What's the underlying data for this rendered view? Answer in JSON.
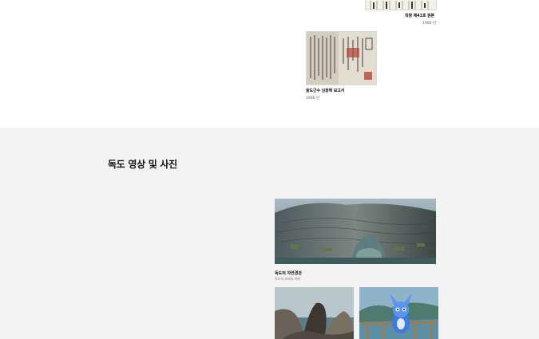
{
  "documents": [
    {
      "title": "칙령 제41호 원본",
      "year": "1900 년"
    },
    {
      "title": "울도군수 심흥택 보고서",
      "year": "1906 년"
    }
  ],
  "section": {
    "title": "독도 영상 및 사진"
  },
  "photos": {
    "featured": {
      "title": "독도의 자연경관",
      "subtitle": "독도의 코끼리 바위"
    },
    "thumbnails": [
      {
        "icon": "sea-lion-rock-photo"
      },
      {
        "icon": "mascot-character-photo"
      }
    ]
  },
  "colors": {
    "section_bg": "#f3f3f3",
    "page_bg": "#ffffff"
  }
}
